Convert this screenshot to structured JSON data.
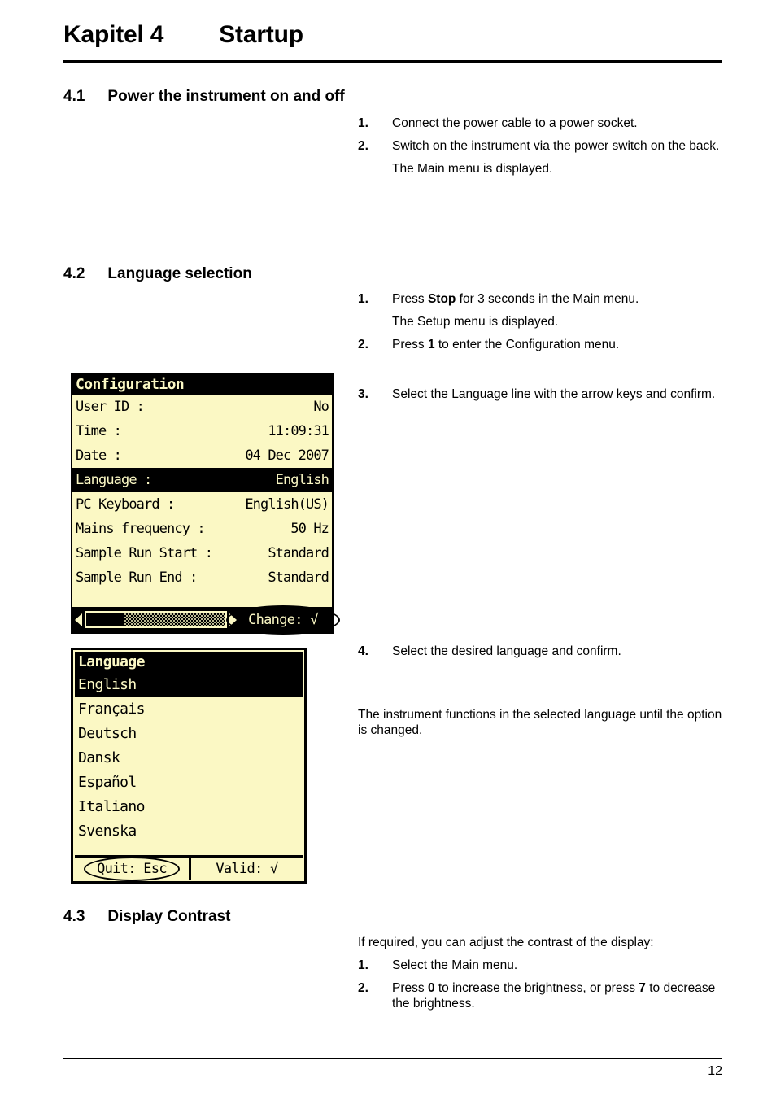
{
  "chapter": {
    "number": "Kapitel 4",
    "title": "Startup"
  },
  "page_number": "12",
  "sections": [
    {
      "number": "4.1",
      "title": "Power the instrument on and off",
      "steps": [
        {
          "num": "1.",
          "text": "Connect the power cable to a power socket."
        },
        {
          "num": "2.",
          "text": "Switch on the instrument via the power switch on the back."
        }
      ],
      "note": "The Main menu is displayed."
    },
    {
      "number": "4.2",
      "title": "Language selection",
      "step1_prefix": "Press ",
      "step1_bold": "Stop",
      "step1_suffix": " for 3 seconds in the Main menu.",
      "note1": "The Setup menu is displayed.",
      "step2_num": "2.",
      "step2_prefix": "Press ",
      "step2_bold": "1",
      "step2_suffix": " to enter the Configuration menu.",
      "step1_num": "1.",
      "step3_num": "3.",
      "step3_text": "Select the Language line with the arrow keys and confirm.",
      "step4_num": "4.",
      "step4_text": "Select the desired language and confirm.",
      "closing": "The instrument functions in the selected language until the option is changed."
    },
    {
      "number": "4.3",
      "title": "Display Contrast",
      "intro": "If required, you can adjust the contrast of the display:",
      "step1_num": "1.",
      "step1_text": "Select the Main menu.",
      "step2_num": "2.",
      "step2_prefix": "Press ",
      "step2_bold1": "0",
      "step2_mid": " to increase the brightness, or press ",
      "step2_bold2": "7",
      "step2_suffix": " to decrease the brightness."
    }
  ],
  "lcd_configuration": {
    "title": "Configuration",
    "rows": [
      {
        "key": "User ID :",
        "value": "No",
        "selected": false
      },
      {
        "key": "Time :",
        "value": "11:09:31",
        "selected": false
      },
      {
        "key": "Date :",
        "value": "04 Dec 2007",
        "selected": false
      },
      {
        "key": "Language :",
        "value": "English",
        "selected": true
      },
      {
        "key": "PC Keyboard :",
        "value": "English(US)",
        "selected": false
      },
      {
        "key": "Mains frequency :",
        "value": "50 Hz",
        "selected": false
      },
      {
        "key": "Sample Run Start :",
        "value": "Standard",
        "selected": false
      },
      {
        "key": "Sample Run End :",
        "value": "Standard",
        "selected": false
      }
    ],
    "softkey": "Change: √",
    "bg_color": "#FBF8C4",
    "fg_color": "#000000"
  },
  "lcd_language": {
    "title": "Language",
    "items": [
      {
        "label": "English",
        "selected": true
      },
      {
        "label": "Français",
        "selected": false
      },
      {
        "label": "Deutsch",
        "selected": false
      },
      {
        "label": "Dansk",
        "selected": false
      },
      {
        "label": "Español",
        "selected": false
      },
      {
        "label": "Italiano",
        "selected": false
      },
      {
        "label": "Svenska",
        "selected": false
      }
    ],
    "softkey_left": "Quit: Esc",
    "softkey_right": "Valid: √",
    "bg_color": "#FBF8C4",
    "fg_color": "#000000"
  }
}
